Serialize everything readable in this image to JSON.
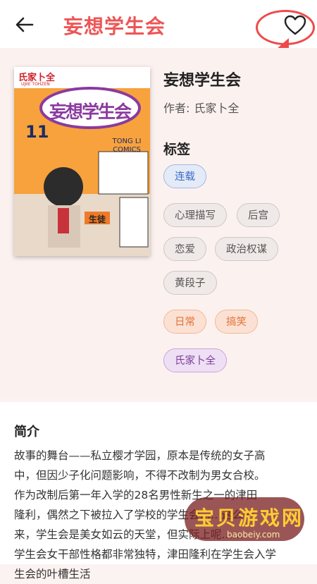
{
  "header": {
    "title": "妄想学生会"
  },
  "book": {
    "title": "妄想学生会",
    "author_label": "作者:",
    "author": "氏家卜全"
  },
  "cover": {
    "publisher_author": "氏家卜全",
    "romaji": "UJIIE TOHZEN",
    "volume": "11",
    "imprint": "TONG LI COMICS",
    "armband": "生徒"
  },
  "tags": {
    "heading": "标签",
    "status": [
      "连载"
    ],
    "genres": [
      "心理描写",
      "后宫",
      "恋爱",
      "政治权谋",
      "黄段子"
    ],
    "themes": [
      "日常",
      "搞笑"
    ],
    "authors": [
      "氏家卜全"
    ]
  },
  "intro": {
    "heading": "简介",
    "lines": [
      "故事的舞台——私立樱才学园，原本是传统的女子高",
      "中，但因少子化问题影响，不得不改制为男女合校。",
      "作为改制后第一年入学的28名男性新生之一的津田",
      "隆利，偶然之下被拉入了学校的学生会……这么一",
      "来，学生会是美女如云的天堂，但实际上呢……",
      "学生会女干部性格都非常独特，津田隆利在学生会入学",
      "生会的叶槽生活"
    ]
  },
  "watermark": {
    "text": "宝贝游戏网",
    "url": "baobeiy.com"
  },
  "colors": {
    "accent": "#ee5555",
    "tag_blue": "#3a68c8",
    "tag_orange": "#e2733a",
    "tag_purple": "#7b3f9b"
  }
}
